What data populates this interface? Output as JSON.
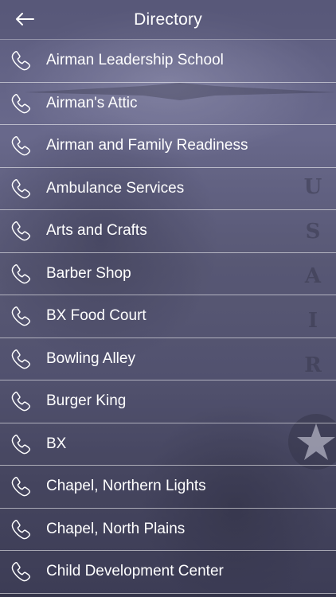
{
  "header": {
    "title": "Directory"
  },
  "icons": {
    "back": "back-arrow-icon",
    "row": "phone-icon"
  },
  "colors": {
    "text": "#ffffff",
    "separator": "#ffffff"
  },
  "list": {
    "items": [
      {
        "label": "Airman Leadership School"
      },
      {
        "label": "Airman's Attic"
      },
      {
        "label": "Airman and Family Readiness"
      },
      {
        "label": "Ambulance Services"
      },
      {
        "label": "Arts and Crafts"
      },
      {
        "label": "Barber Shop"
      },
      {
        "label": "BX Food Court"
      },
      {
        "label": "Bowling Alley"
      },
      {
        "label": "Burger King"
      },
      {
        "label": "BX"
      },
      {
        "label": "Chapel, Northern Lights"
      },
      {
        "label": "Chapel, North Plains"
      },
      {
        "label": "Child Development Center"
      }
    ]
  }
}
